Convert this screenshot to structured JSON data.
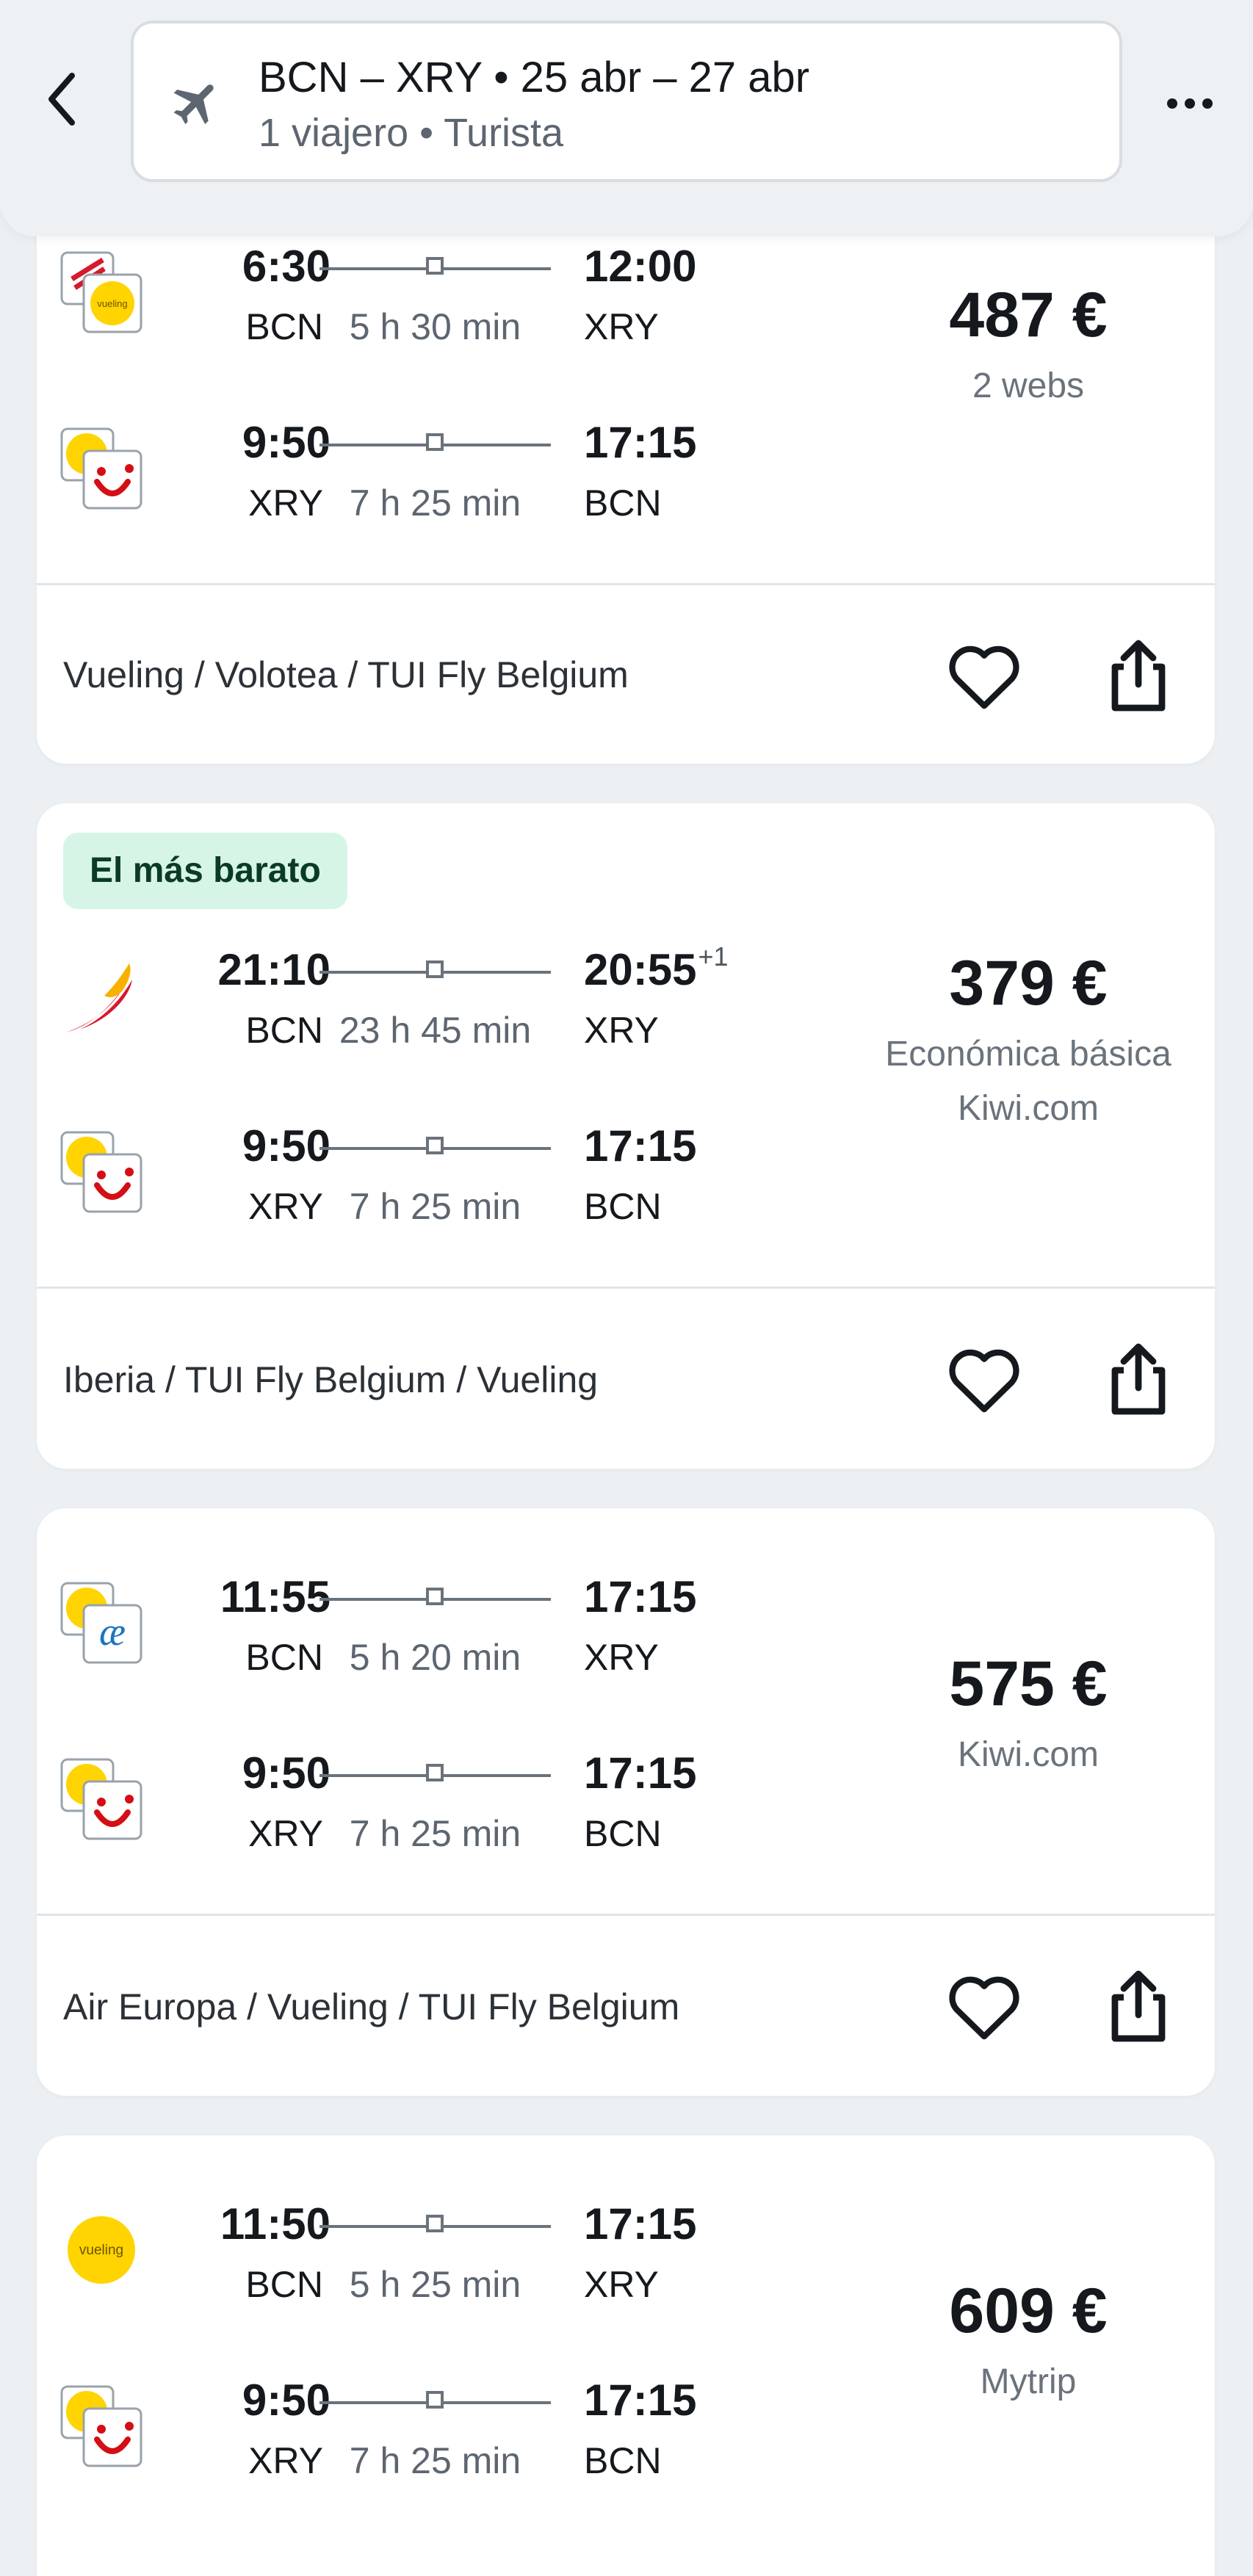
{
  "header": {
    "route": "BCN – XRY",
    "dot": "•",
    "dates": "25 abr – 27 abr",
    "travelers": "1 viajero",
    "cabin": "Turista"
  },
  "results": [
    {
      "badge": "",
      "legs": [
        {
          "dep_time": "6:30",
          "arr_time": "12:00",
          "arr_day": "",
          "from": "BCN",
          "to": "XRY",
          "duration": "5 h 30 min",
          "logo": "iberia-vueling-icon"
        },
        {
          "dep_time": "9:50",
          "arr_time": "17:15",
          "arr_day": "",
          "from": "XRY",
          "to": "BCN",
          "duration": "7 h 25 min",
          "logo": "vueling-tui-icon"
        }
      ],
      "price": "487 €",
      "price_sub1": "2 webs",
      "price_sub2": "",
      "airlines": "Vueling / Volotea / TUI Fly Belgium"
    },
    {
      "badge": "El más barato",
      "legs": [
        {
          "dep_time": "21:10",
          "arr_time": "20:55",
          "arr_day": "+1",
          "from": "BCN",
          "to": "XRY",
          "duration": "23 h 45 min",
          "logo": "iberia-icon"
        },
        {
          "dep_time": "9:50",
          "arr_time": "17:15",
          "arr_day": "",
          "from": "XRY",
          "to": "BCN",
          "duration": "7 h 25 min",
          "logo": "vueling-tui-icon"
        }
      ],
      "price": "379 €",
      "price_sub1": "Económica básica",
      "price_sub2": "Kiwi.com",
      "airlines": "Iberia / TUI Fly Belgium / Vueling"
    },
    {
      "badge": "",
      "legs": [
        {
          "dep_time": "11:55",
          "arr_time": "17:15",
          "arr_day": "",
          "from": "BCN",
          "to": "XRY",
          "duration": "5 h 20 min",
          "logo": "vueling-aireuropa-icon"
        },
        {
          "dep_time": "9:50",
          "arr_time": "17:15",
          "arr_day": "",
          "from": "XRY",
          "to": "BCN",
          "duration": "7 h 25 min",
          "logo": "vueling-tui-icon"
        }
      ],
      "price": "575 €",
      "price_sub1": "Kiwi.com",
      "price_sub2": "",
      "airlines": "Air Europa / Vueling / TUI Fly Belgium"
    },
    {
      "badge": "",
      "legs": [
        {
          "dep_time": "11:50",
          "arr_time": "17:15",
          "arr_day": "",
          "from": "BCN",
          "to": "XRY",
          "duration": "5 h 25 min",
          "logo": "vueling-icon"
        },
        {
          "dep_time": "9:50",
          "arr_time": "17:15",
          "arr_day": "",
          "from": "XRY",
          "to": "BCN",
          "duration": "7 h 25 min",
          "logo": "vueling-tui-icon"
        }
      ],
      "price": "609 €",
      "price_sub1": "Mytrip",
      "price_sub2": "",
      "airlines": ""
    }
  ],
  "logo_text": {
    "vueling": "vueling"
  },
  "colors": {
    "background": "#edf0f3",
    "card": "#ffffff",
    "badge_bg": "#d6f5e6",
    "badge_text": "#0c3b25",
    "vueling_yellow": "#ffd400",
    "tui_red": "#d40e14",
    "iberia_red": "#d7192d",
    "iberia_yellow": "#f9b000",
    "aireuropa_blue": "#1c75bc"
  }
}
